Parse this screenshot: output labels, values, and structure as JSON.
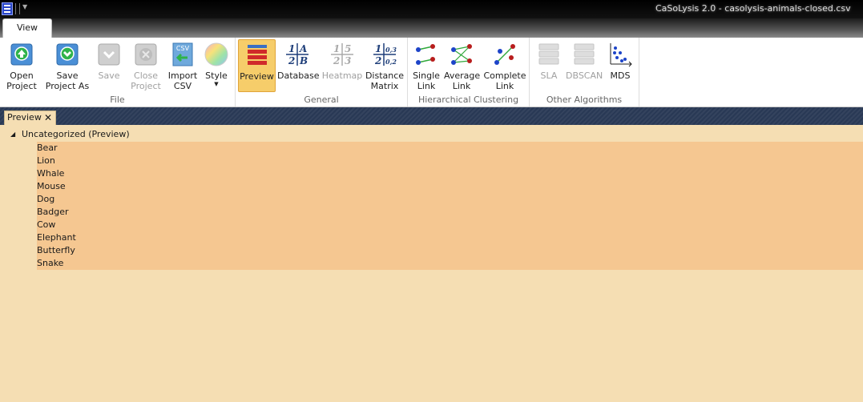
{
  "window": {
    "title": "CaSoLysis 2.0 - casolysis-animals-closed.csv"
  },
  "ribbon": {
    "tabs": [
      {
        "label": "View"
      }
    ],
    "groups": {
      "file": {
        "label": "File"
      },
      "general": {
        "label": "General"
      },
      "hierarchical": {
        "label": "Hierarchical Clustering"
      },
      "other": {
        "label": "Other Algorithms"
      }
    },
    "buttons": {
      "open_project": "Open\nProject",
      "save_project_as": "Save\nProject As",
      "save": "Save",
      "close_project": "Close\nProject",
      "import_csv": "Import\nCSV",
      "style": "Style",
      "preview": "Preview",
      "database": "Database",
      "heatmap": "Heatmap",
      "distance_matrix": "Distance\nMatrix",
      "single_link": "Single\nLink",
      "average_link": "Average\nLink",
      "complete_link": "Complete\nLink",
      "sla": "SLA",
      "dbscan": "DBSCAN",
      "mds": "MDS"
    },
    "icon_text": {
      "csv": "CSV",
      "db_1": "1",
      "db_a": "A",
      "db_2": "2",
      "db_b": "B",
      "hm_1": "1",
      "hm_5": "5",
      "hm_2": "2",
      "hm_3": "3",
      "dm_1": "1",
      "dm_03": "0,3",
      "dm_2": "2",
      "dm_02": "0,2"
    }
  },
  "document": {
    "tab_label": "Preview",
    "group_label": "Uncategorized (Preview)",
    "items": [
      "Bear",
      "Lion",
      "Whale",
      "Mouse",
      "Dog",
      "Badger",
      "Cow",
      "Elephant",
      "Butterfly",
      "Snake"
    ]
  },
  "colors": {
    "background": "#f5deb3",
    "items_highlight": "#f5c791",
    "doc_header": "#293955",
    "active_button": "#f6cd6a"
  }
}
